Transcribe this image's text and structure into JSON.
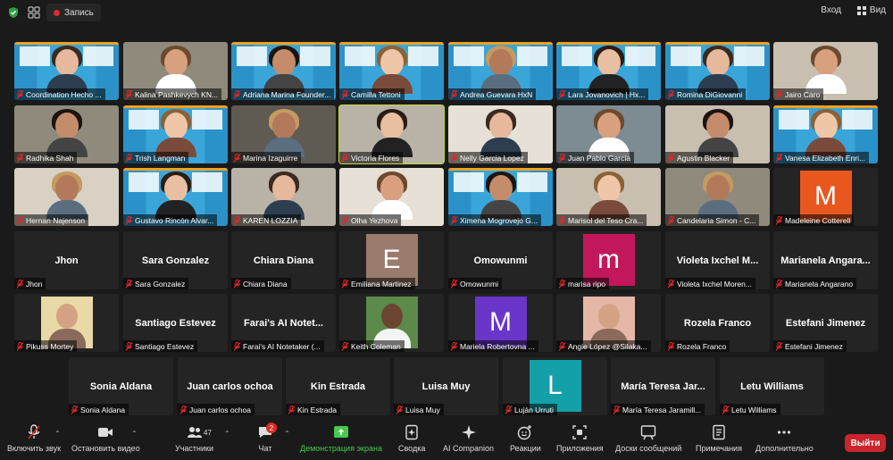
{
  "topbar": {
    "record_label": "Запись",
    "signin_label": "Вход",
    "view_label": "Вид"
  },
  "colors": {
    "speaker_outline": "#c8d633",
    "muted_icon": "#e02828",
    "leave_button": "#c9252c",
    "share_green": "#45c94f"
  },
  "participants": [
    {
      "name": "Coordination Hecho ...",
      "video": "conf"
    },
    {
      "name": "Kalina Pashkevych KN...",
      "video": "cam"
    },
    {
      "name": "Adriana Marina Founder...",
      "video": "conf"
    },
    {
      "name": "Camilla Tettoni",
      "video": "conf"
    },
    {
      "name": "Andrea Guevara HxN",
      "video": "conf"
    },
    {
      "name": "Lara Jovanovich | Hx...",
      "video": "conf"
    },
    {
      "name": "Romina DiGiovanni",
      "video": "conf"
    },
    {
      "name": "Jairo Caro",
      "video": "cam"
    },
    {
      "name": "Radhika Shah",
      "video": "cam"
    },
    {
      "name": "Trish Langman",
      "video": "conf"
    },
    {
      "name": "Marina Izaguirre",
      "video": "cam"
    },
    {
      "name": "Victoria Flores",
      "video": "cam",
      "speaking": true
    },
    {
      "name": "Nelly Garcia Lopez",
      "video": "cam"
    },
    {
      "name": "Juan Pablo Garcia",
      "video": "cam"
    },
    {
      "name": "Agustin Blacker",
      "video": "cam"
    },
    {
      "name": "Vanesa Elizabeth Enri...",
      "video": "conf"
    },
    {
      "name": "Hernan Najenson",
      "video": "cam"
    },
    {
      "name": "Gustavo Rincón Alvar...",
      "video": "conf"
    },
    {
      "name": "KAREN LOZZIA",
      "video": "cam"
    },
    {
      "name": "Olha Yezhova",
      "video": "cam"
    },
    {
      "name": "Ximena Mogrovejo G...",
      "video": "conf"
    },
    {
      "name": "Marisol del Teso Cra...",
      "video": "cam"
    },
    {
      "name": "Candelaria Simon - C...",
      "video": "cam"
    },
    {
      "name": "Madeleine Cotterell",
      "video": "letter",
      "letter": "M",
      "color": "#e8581e"
    },
    {
      "name": "Jhon",
      "video": "off",
      "title": "Jhon"
    },
    {
      "name": "Sara Gonzalez",
      "video": "off",
      "title": "Sara Gonzalez"
    },
    {
      "name": "Chiara Diana",
      "video": "off",
      "title": "Chiara Diana"
    },
    {
      "name": "Emiliana Martinez",
      "video": "letter",
      "letter": "E",
      "color": "#9a7b6c"
    },
    {
      "name": "Omowunmi",
      "video": "off",
      "title": "Omowunmi"
    },
    {
      "name": "marisa ripo",
      "video": "letter",
      "letter": "m",
      "color": "#c2185b"
    },
    {
      "name": "Violeta Ixchel Moren...",
      "video": "off",
      "title": "Violeta  Ixchel  M..."
    },
    {
      "name": "Marianela Angarano",
      "video": "off",
      "title": "Marianela  Angara..."
    },
    {
      "name": "Pikuss Mortey",
      "video": "photo"
    },
    {
      "name": "Santiago Estevez",
      "video": "off",
      "title": "Santiago Estevez"
    },
    {
      "name": "Farai's AI Notetaker (...",
      "video": "off",
      "title": "Farai's AI Notet..."
    },
    {
      "name": "Keith Coleman",
      "video": "photo"
    },
    {
      "name": "Mariela Robertovna ...",
      "video": "letter",
      "letter": "M",
      "color": "#6a35c9"
    },
    {
      "name": "Angie López @Silaka...",
      "video": "photo"
    },
    {
      "name": "Rozela Franco",
      "video": "off",
      "title": "Rozela Franco"
    },
    {
      "name": "Estefani Jimenez",
      "video": "off",
      "title": "Estefani Jimenez"
    },
    {
      "name": "Sonia Aldana",
      "video": "off",
      "title": "Sonia Aldana"
    },
    {
      "name": "Juan carlos ochoa",
      "video": "off",
      "title": "Juan carlos ochoa"
    },
    {
      "name": "Kin Estrada",
      "video": "off",
      "title": "Kin Estrada"
    },
    {
      "name": "Luisa Muy",
      "video": "off",
      "title": "Luisa Muy"
    },
    {
      "name": "Luján Urruti",
      "video": "letter",
      "letter": "L",
      "color": "#14a0a8"
    },
    {
      "name": "María Teresa Jaramill...",
      "video": "off",
      "title": "María Teresa Jar..."
    },
    {
      "name": "Letu Williams",
      "video": "off",
      "title": "Letu Williams"
    }
  ],
  "toolbar": {
    "mute": "Включить звук",
    "video": "Остановить видео",
    "participants": "Участники",
    "participants_count": "47",
    "chat": "Чат",
    "chat_badge": "2",
    "share": "Демонстрация экрана",
    "summary": "Сводка",
    "ai": "AI Companion",
    "reactions": "Реакции",
    "apps": "Приложения",
    "boards": "Доски сообщений",
    "notes": "Примечания",
    "more": "Дополнительно",
    "leave": "Выйти"
  }
}
